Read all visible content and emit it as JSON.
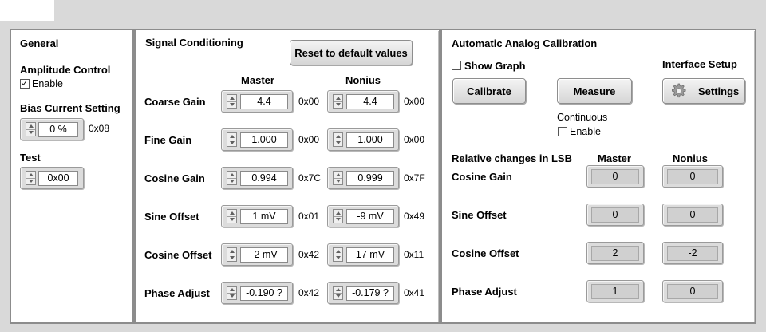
{
  "general": {
    "title": "General",
    "amplitude_control": "Amplitude Control",
    "enable_label": "Enable",
    "enable_checked": true,
    "bias_label": "Bias Current Setting",
    "bias_value": "0 %",
    "bias_hex": "0x08",
    "test_label": "Test",
    "test_value": "0x00"
  },
  "signal": {
    "title": "Signal Conditioning",
    "reset_button": "Reset to default values",
    "master_header": "Master",
    "nonius_header": "Nonius",
    "rows": [
      {
        "label": "Coarse Gain",
        "master": "4.4",
        "master_hex": "0x00",
        "nonius": "4.4",
        "nonius_hex": "0x00"
      },
      {
        "label": "Fine Gain",
        "master": "1.000",
        "master_hex": "0x00",
        "nonius": "1.000",
        "nonius_hex": "0x00"
      },
      {
        "label": "Cosine Gain",
        "master": "0.994",
        "master_hex": "0x7C",
        "nonius": "0.999",
        "nonius_hex": "0x7F"
      },
      {
        "label": "Sine Offset",
        "master": "1 mV",
        "master_hex": "0x01",
        "nonius": "-9 mV",
        "nonius_hex": "0x49"
      },
      {
        "label": "Cosine Offset",
        "master": "-2 mV",
        "master_hex": "0x42",
        "nonius": "17 mV",
        "nonius_hex": "0x11"
      },
      {
        "label": "Phase Adjust",
        "master": "-0.190 ?",
        "master_hex": "0x42",
        "nonius": "-0.179 ?",
        "nonius_hex": "0x41"
      }
    ]
  },
  "auto": {
    "title": "Automatic Analog Calibration",
    "show_graph": "Show Graph",
    "show_graph_checked": false,
    "interface_setup": "Interface Setup",
    "calibrate_button": "Calibrate",
    "measure_button": "Measure",
    "settings_button": "Settings",
    "continuous_label": "Continuous",
    "continuous_enable": "Enable",
    "continuous_checked": false,
    "relative_title": "Relative changes in LSB",
    "master_header": "Master",
    "nonius_header": "Nonius",
    "rows": [
      {
        "label": "Cosine Gain",
        "master": "0",
        "nonius": "0"
      },
      {
        "label": "Sine Offset",
        "master": "0",
        "nonius": "0"
      },
      {
        "label": "Cosine Offset",
        "master": "2",
        "nonius": "-2"
      },
      {
        "label": "Phase Adjust",
        "master": "1",
        "nonius": "0"
      }
    ]
  },
  "icons": {
    "spinner": "spinner-arrows-icon",
    "gear": "gear-icon",
    "check": "checkmark-icon"
  }
}
